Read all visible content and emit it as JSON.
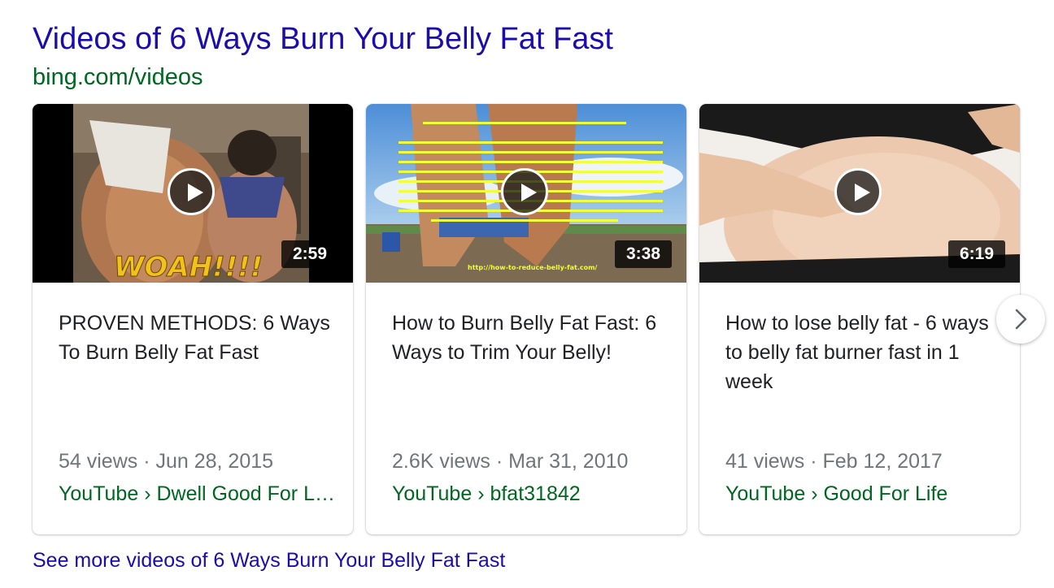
{
  "header": {
    "title": "Videos of 6 Ways Burn Your Belly Fat Fast",
    "source": "bing.com/videos"
  },
  "videos": [
    {
      "title": "PROVEN METHODS: 6 Ways To Burn Belly Fat Fast",
      "duration": "2:59",
      "meta": "54 views · Jun 28, 2015",
      "channel": "YouTube › Dwell Good For Life",
      "thumb_text": "WOAH!!!!"
    },
    {
      "title": "How to Burn Belly Fat Fast: 6 Ways to Trim Your Belly!",
      "duration": "3:38",
      "meta": "2.6K views · Mar 31, 2010",
      "channel": "YouTube › bfat31842",
      "thumb_text": "http://how-to-reduce-belly-fat.com/"
    },
    {
      "title": "How to lose belly fat - 6 ways to belly fat burner fast in 1 week",
      "duration": "6:19",
      "meta": "41 views · Feb 12, 2017",
      "channel": "YouTube › Good For Life"
    }
  ],
  "next_icon": "chevron-right-icon",
  "play_icon": "play-icon",
  "see_more": "See more videos of 6 Ways Burn Your Belly Fat Fast",
  "colors": {
    "link": "#1a0dab",
    "url_green": "#006621",
    "meta_gray": "#70757a",
    "text": "#202124"
  }
}
